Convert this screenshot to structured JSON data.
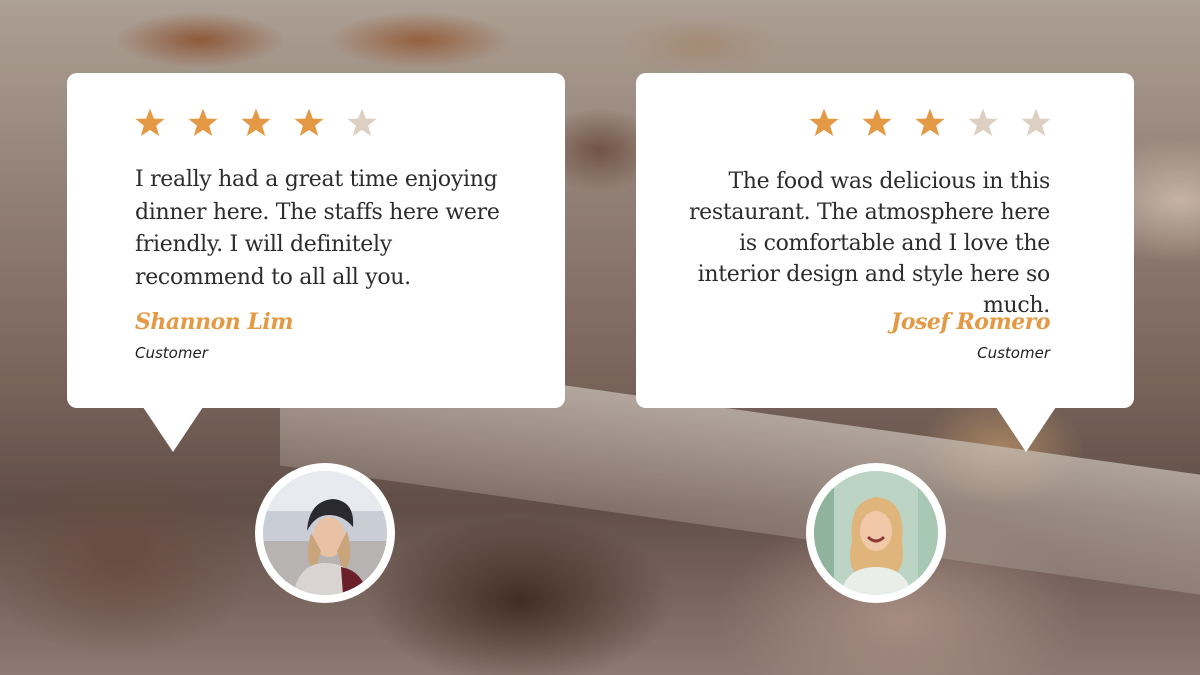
{
  "colors": {
    "accent": "#e49a45",
    "star_filled": "#e49a45",
    "star_empty": "#ddd0c2",
    "card": "#ffffff",
    "text": "#2c2c2c"
  },
  "testimonials": [
    {
      "rating": 4,
      "max_rating": 5,
      "quote": "I really had a great time enjoying dinner here. The staffs here were friendly. I will definitely recommend to all all you.",
      "name": "Shannon Lim",
      "role": "Customer",
      "avatar_icon": "woman-in-beanie-photo"
    },
    {
      "rating": 3,
      "max_rating": 5,
      "quote": "The food was delicious in this restaurant. The atmosphere here is comfortable and I love the interior design and style here so much.",
      "name": "Josef Romero",
      "role": "Customer",
      "avatar_icon": "smiling-woman-photo"
    }
  ]
}
